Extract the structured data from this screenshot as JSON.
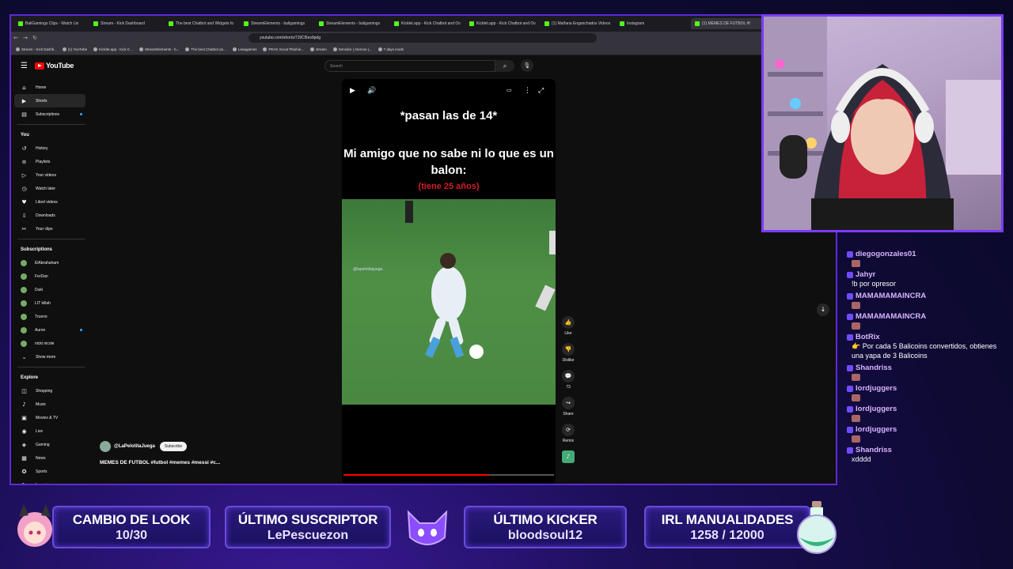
{
  "browser": {
    "tabs": [
      "BaliGamings Clips - Watch Lin",
      "Stream - Kick Dashboard",
      "The best Chatbot and Widgets fo",
      "StreamElements - baligamings",
      "StreamElements - baligamings",
      "Kicklet.app - Kick Chatbot and Ov",
      "Kicklet.app - Kick Chatbot and Ov",
      "(1) Mañana Enganchados Videos",
      "Instagram",
      "(1) MEMES DE FUTBOL #f"
    ],
    "url": "youtube.com/shorts/7J9Cl5es9pdg",
    "bookmarks": [
      "Stream - Kick Dashb..",
      "(1) YouTube",
      "Kicklet.app - Kick C...",
      "StreamElements - b...",
      "The best Chatbot an...",
      "Leaagames",
      "PEAK Scout Plushie...",
      "stream",
      "Servidor | Aternos |...",
      "7 days mods"
    ]
  },
  "youtube": {
    "logo": "YouTube",
    "search_placeholder": "Search",
    "nav": [
      "Home",
      "Shorts",
      "Subscriptions"
    ],
    "you_header": "You",
    "you_items": [
      "History",
      "Playlists",
      "Your videos",
      "Watch later",
      "Liked videos",
      "Downloads",
      "Your clips"
    ],
    "subs_header": "Subscriptions",
    "subs": [
      "ElAbrahaham",
      "FerDan",
      "Duki",
      "LIT killah",
      "Trueno",
      "Auron",
      "nicki nicole",
      "Show more"
    ],
    "explore_header": "Explore",
    "explore": [
      "Shopping",
      "Music",
      "Movies & TV",
      "Live",
      "Gaming",
      "News",
      "Sports",
      "Learning"
    ],
    "short": {
      "caption1": "*pasan las de 14*",
      "caption2": "Mi amigo que no sabe ni lo que es un balon:",
      "caption3": "(tiene 25 años)",
      "watermark": "@lapelotitajuega",
      "channel": "@LaPelotitaJuega",
      "subscribe": "Subscribe",
      "title": "MEMES DE FUTBOL #futbol #memes #messi #c...",
      "progress": 0.69,
      "actions": {
        "like": "Like",
        "dislike": "Dislike",
        "comments": "73",
        "share": "Share",
        "remix": "Remix"
      }
    },
    "colors": {
      "accent": "#ff0000",
      "caption_red": "#d21e2b"
    }
  },
  "chat": [
    {
      "user": "diegogonzales01",
      "text": "",
      "emote": true
    },
    {
      "user": "Jahyr",
      "text": "!b por opresor",
      "emote": false
    },
    {
      "user": "MAMAMAMAINCRA",
      "text": "",
      "emote": true
    },
    {
      "user": "MAMAMAMAINCRA",
      "text": "",
      "emote": true
    },
    {
      "user": "BotRix",
      "text": "👉 Por cada 5 Balicoins convertidos, obtienes una yapa de 3 Balicoins",
      "emote": false
    },
    {
      "user": "Shandriss",
      "text": "",
      "emote": true
    },
    {
      "user": "lordjuggers",
      "text": "",
      "emote": true
    },
    {
      "user": "lordjuggers",
      "text": "",
      "emote": true
    },
    {
      "user": "lordjuggers",
      "text": "",
      "emote": true
    },
    {
      "user": "Shandriss",
      "text": "xdddd",
      "emote": false
    }
  ],
  "overlay": {
    "look": {
      "title": "CAMBIO DE LOOK",
      "value": "10/30"
    },
    "sub": {
      "title": "ÚLTIMO SUSCRIPTOR",
      "value": "LePescuezon"
    },
    "kicker": {
      "title": "ÚLTIMO KICKER",
      "value": "bloodsoul12"
    },
    "irl": {
      "title": "IRL MANUALIDADES",
      "value": "1258 / 12000"
    }
  }
}
